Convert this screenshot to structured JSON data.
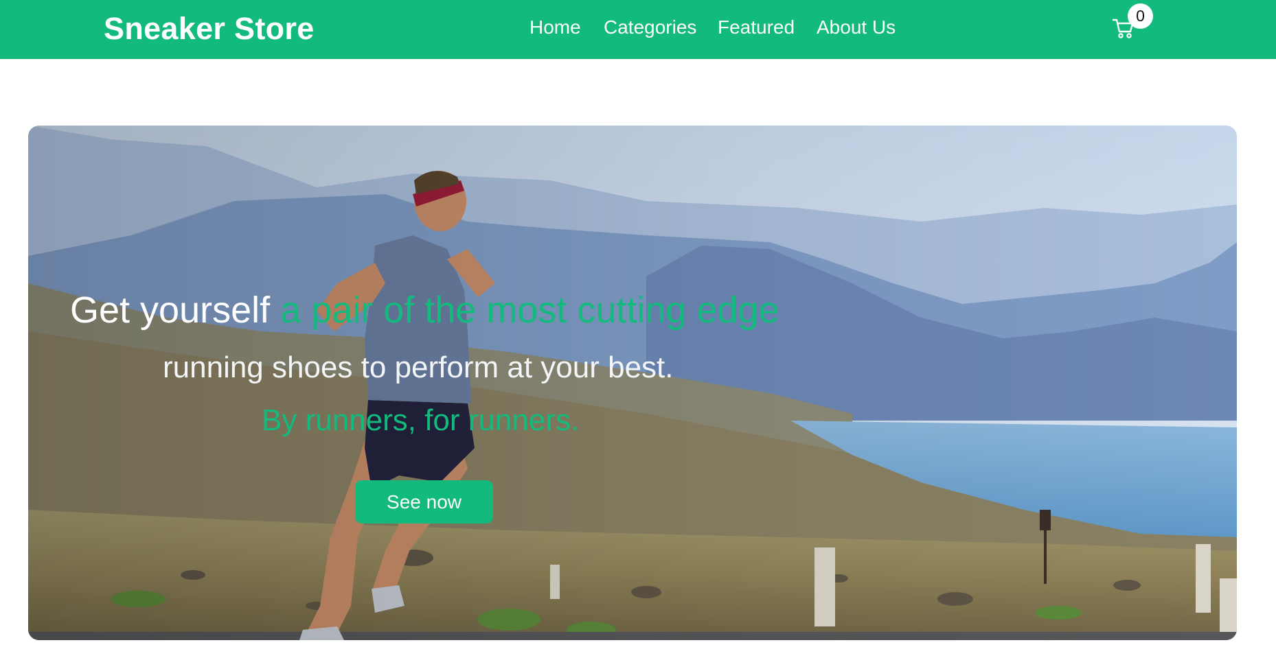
{
  "header": {
    "brand": "Sneaker Store",
    "nav": [
      {
        "label": "Home"
      },
      {
        "label": "Categories"
      },
      {
        "label": "Featured"
      },
      {
        "label": "About Us"
      }
    ],
    "cart": {
      "icon": "cart-icon",
      "count": "0"
    }
  },
  "hero": {
    "headline_plain": "Get yourself",
    "headline_accent": "a pair of the most cutting edge",
    "subline": "running shoes to perform at your best.",
    "tagline": "By runners, for runners.",
    "button_label": "See now",
    "image": "runner-on-mountain-road-photo"
  },
  "colors": {
    "brand_green": "#12bb7d",
    "white": "#ffffff"
  }
}
